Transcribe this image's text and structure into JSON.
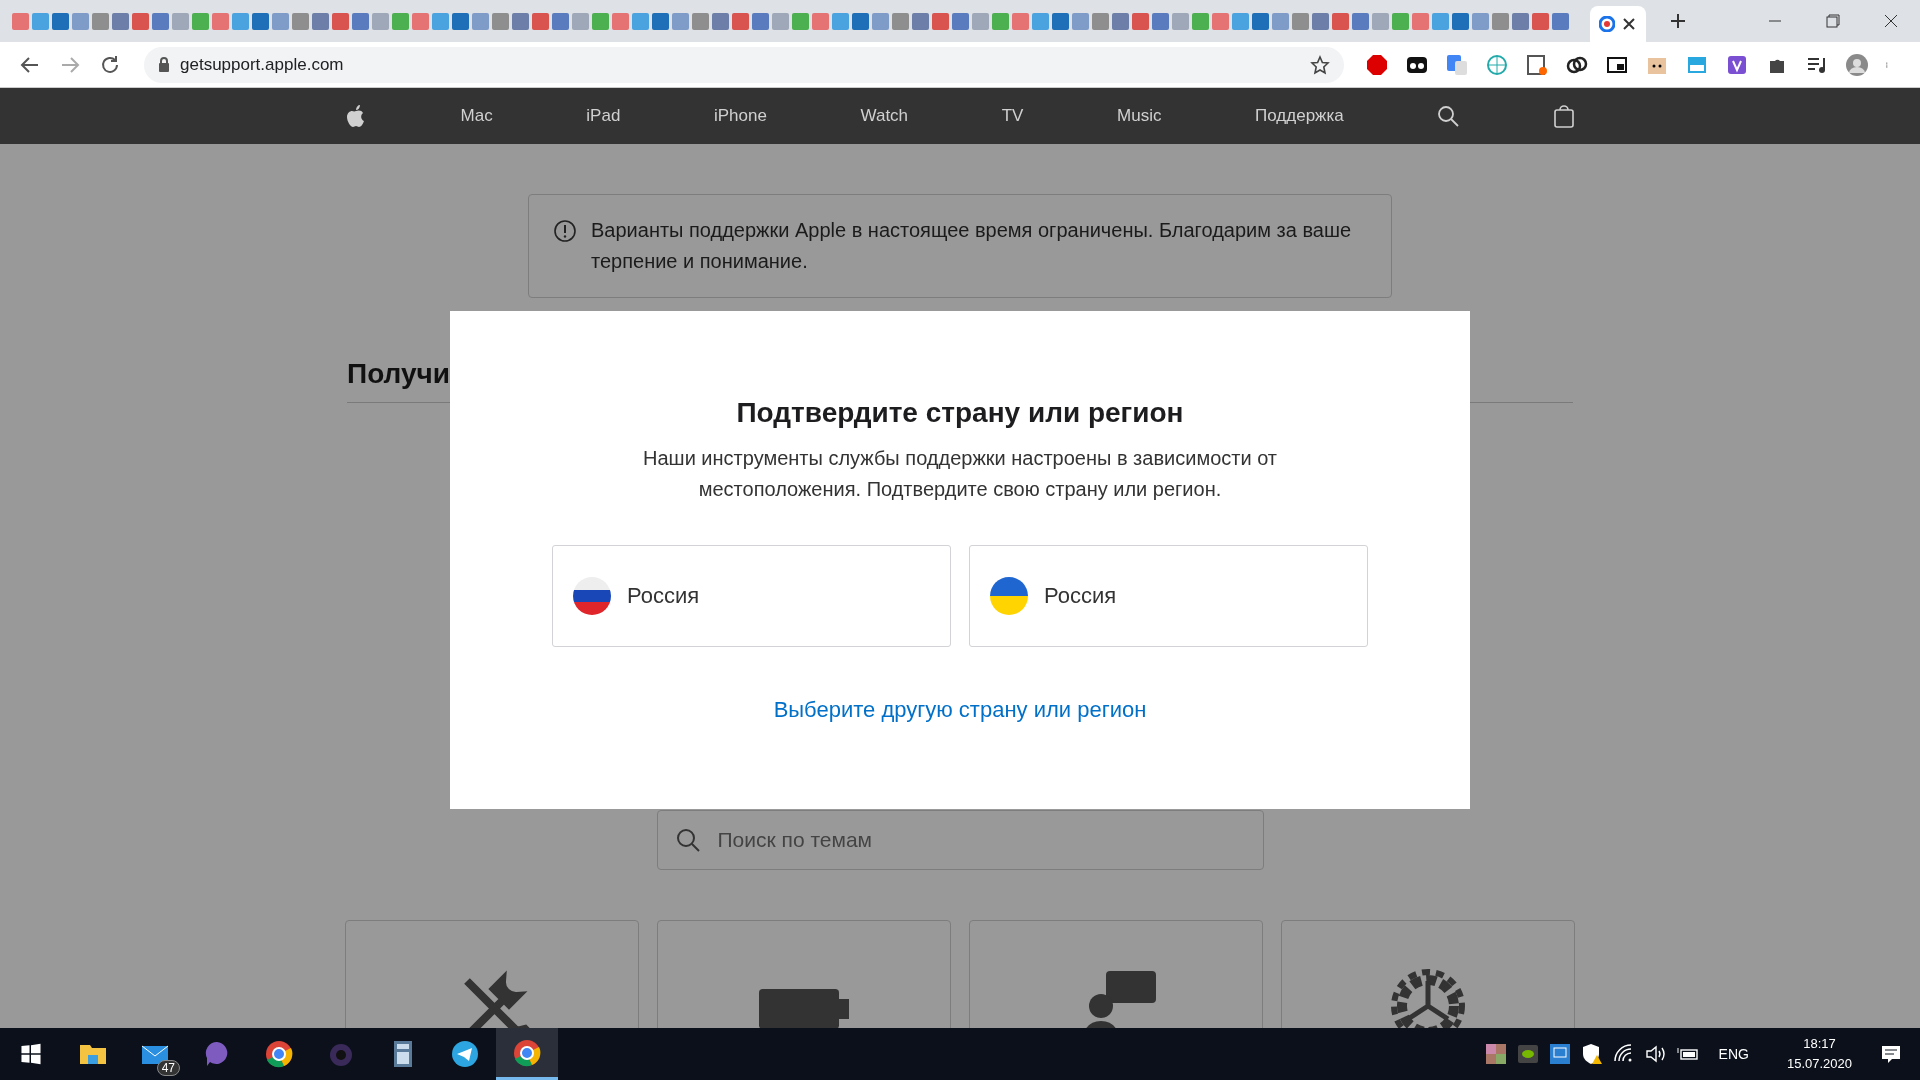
{
  "browser": {
    "url": "getsupport.apple.com"
  },
  "nav": {
    "items": [
      "Mac",
      "iPad",
      "iPhone",
      "Watch",
      "TV",
      "Music",
      "Поддержка"
    ]
  },
  "notice": "Варианты поддержки Apple в настоящее время ограничены. Благодарим за ваше терпение и понимание.",
  "heading": "Получи",
  "search": {
    "placeholder": "Поиск по темам"
  },
  "modal": {
    "title": "Подтвердите страну или регион",
    "description": "Наши инструменты службы поддержки настроены в зависимости от местоположения. Подтвердите свою страну или регион.",
    "countries": [
      {
        "name": "Россия",
        "kind": "russia"
      },
      {
        "name": "Россия",
        "kind": "ukraine"
      }
    ],
    "link": "Выберите другую страну или регион"
  },
  "taskbar": {
    "mail_badge": "47",
    "language": "ENG",
    "time": "18:17",
    "date": "15.07.2020"
  }
}
